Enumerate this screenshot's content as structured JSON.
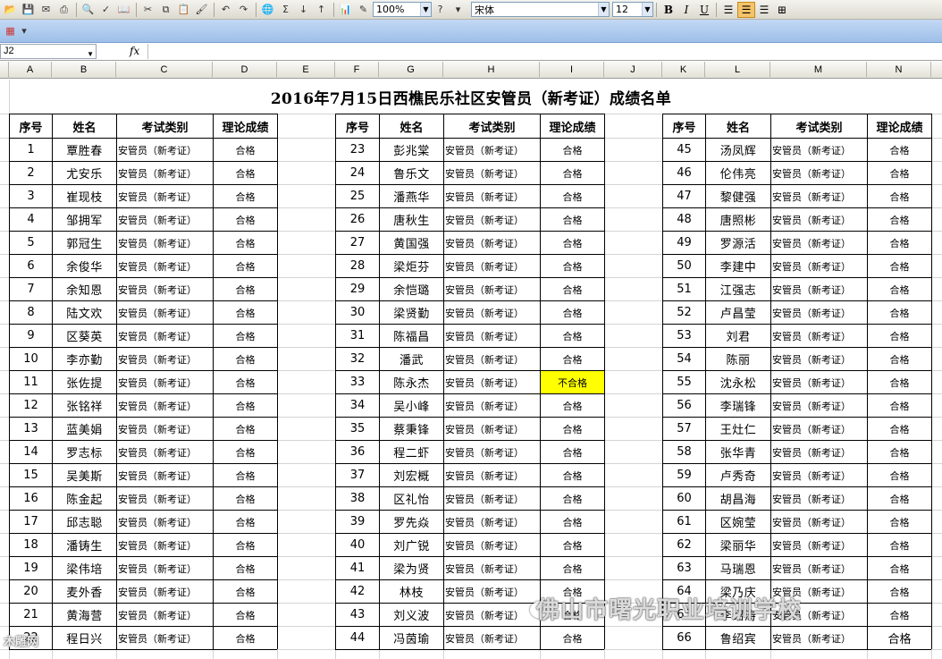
{
  "toolbar": {
    "zoom": "100%",
    "font_name": "宋体",
    "font_size": "12",
    "bold": "B",
    "italic": "I",
    "underline": "U",
    "sum": "Σ"
  },
  "formula_bar": {
    "name_box": "J2",
    "fx": "fx",
    "content": ""
  },
  "columns": [
    "A",
    "B",
    "C",
    "D",
    "E",
    "F",
    "G",
    "H",
    "I",
    "J",
    "K",
    "L",
    "M",
    "N"
  ],
  "sheet": {
    "title": "2016年7月15日西樵民乐社区安管员（新考证）成绩名单",
    "headers": [
      "序号",
      "姓名",
      "考试类别",
      "理论成绩"
    ],
    "category": "安管员（新考证）",
    "pass": "合格",
    "fail": "不合格",
    "block1": [
      {
        "no": "1",
        "name": "覃胜春",
        "result": "合格"
      },
      {
        "no": "2",
        "name": "尤安乐",
        "result": "合格"
      },
      {
        "no": "3",
        "name": "崔现枝",
        "result": "合格"
      },
      {
        "no": "4",
        "name": "邹拥军",
        "result": "合格"
      },
      {
        "no": "5",
        "name": "郭冠生",
        "result": "合格"
      },
      {
        "no": "6",
        "name": "余俊华",
        "result": "合格"
      },
      {
        "no": "7",
        "name": "余知恩",
        "result": "合格"
      },
      {
        "no": "8",
        "name": "陆文欢",
        "result": "合格"
      },
      {
        "no": "9",
        "name": "区葵英",
        "result": "合格"
      },
      {
        "no": "10",
        "name": "李亦勤",
        "result": "合格"
      },
      {
        "no": "11",
        "name": "张佐提",
        "result": "合格"
      },
      {
        "no": "12",
        "name": "张铭祥",
        "result": "合格"
      },
      {
        "no": "13",
        "name": "蓝美娟",
        "result": "合格"
      },
      {
        "no": "14",
        "name": "罗志标",
        "result": "合格"
      },
      {
        "no": "15",
        "name": "吴美斯",
        "result": "合格"
      },
      {
        "no": "16",
        "name": "陈金起",
        "result": "合格"
      },
      {
        "no": "17",
        "name": "邱志聪",
        "result": "合格"
      },
      {
        "no": "18",
        "name": "潘铸生",
        "result": "合格"
      },
      {
        "no": "19",
        "name": "梁伟培",
        "result": "合格"
      },
      {
        "no": "20",
        "name": "麦外香",
        "result": "合格"
      },
      {
        "no": "21",
        "name": "黄海营",
        "result": "合格"
      },
      {
        "no": "22",
        "name": "程日兴",
        "result": "合格"
      }
    ],
    "block2": [
      {
        "no": "23",
        "name": "彭兆棠",
        "result": "合格"
      },
      {
        "no": "24",
        "name": "鲁乐文",
        "result": "合格"
      },
      {
        "no": "25",
        "name": "潘燕华",
        "result": "合格"
      },
      {
        "no": "26",
        "name": "唐秋生",
        "result": "合格"
      },
      {
        "no": "27",
        "name": "黄国强",
        "result": "合格"
      },
      {
        "no": "28",
        "name": "梁炬芬",
        "result": "合格"
      },
      {
        "no": "29",
        "name": "余恺璐",
        "result": "合格"
      },
      {
        "no": "30",
        "name": "梁贤勤",
        "result": "合格"
      },
      {
        "no": "31",
        "name": "陈福昌",
        "result": "合格"
      },
      {
        "no": "32",
        "name": "潘武",
        "result": "合格"
      },
      {
        "no": "33",
        "name": "陈永杰",
        "result": "不合格"
      },
      {
        "no": "34",
        "name": "吴小峰",
        "result": "合格"
      },
      {
        "no": "35",
        "name": "蔡秉锋",
        "result": "合格"
      },
      {
        "no": "36",
        "name": "程二虾",
        "result": "合格"
      },
      {
        "no": "37",
        "name": "刘宏概",
        "result": "合格"
      },
      {
        "no": "38",
        "name": "区礼怡",
        "result": "合格"
      },
      {
        "no": "39",
        "name": "罗先焱",
        "result": "合格"
      },
      {
        "no": "40",
        "name": "刘广锐",
        "result": "合格"
      },
      {
        "no": "41",
        "name": "梁为贤",
        "result": "合格"
      },
      {
        "no": "42",
        "name": "林枝",
        "result": "合格"
      },
      {
        "no": "43",
        "name": "刘义波",
        "result": "合格"
      },
      {
        "no": "44",
        "name": "冯茵瑜",
        "result": "合格"
      }
    ],
    "block3": [
      {
        "no": "45",
        "name": "汤凤辉",
        "result": "合格"
      },
      {
        "no": "46",
        "name": "伦伟亮",
        "result": "合格"
      },
      {
        "no": "47",
        "name": "黎健强",
        "result": "合格"
      },
      {
        "no": "48",
        "name": "唐照彬",
        "result": "合格"
      },
      {
        "no": "49",
        "name": "罗源活",
        "result": "合格"
      },
      {
        "no": "50",
        "name": "李建中",
        "result": "合格"
      },
      {
        "no": "51",
        "name": "江强志",
        "result": "合格"
      },
      {
        "no": "52",
        "name": "卢昌莹",
        "result": "合格"
      },
      {
        "no": "53",
        "name": "刘君",
        "result": "合格"
      },
      {
        "no": "54",
        "name": "陈丽",
        "result": "合格"
      },
      {
        "no": "55",
        "name": "沈永松",
        "result": "合格"
      },
      {
        "no": "56",
        "name": "李瑞锋",
        "result": "合格"
      },
      {
        "no": "57",
        "name": "王灶仁",
        "result": "合格"
      },
      {
        "no": "58",
        "name": "张华青",
        "result": "合格"
      },
      {
        "no": "59",
        "name": "卢秀奇",
        "result": "合格"
      },
      {
        "no": "60",
        "name": "胡昌海",
        "result": "合格"
      },
      {
        "no": "61",
        "name": "区婉莹",
        "result": "合格"
      },
      {
        "no": "62",
        "name": "梁丽华",
        "result": "合格"
      },
      {
        "no": "63",
        "name": "马瑞恩",
        "result": "合格"
      },
      {
        "no": "64",
        "name": "梁乃庆",
        "result": "合格"
      },
      {
        "no": "65",
        "name": "李绍涛",
        "result": "合格"
      },
      {
        "no": "66",
        "name": "鲁绍宾",
        "result": "合格"
      }
    ]
  },
  "watermark": "佛山市曙光职业培训学校",
  "corner_signature": "木雕网"
}
